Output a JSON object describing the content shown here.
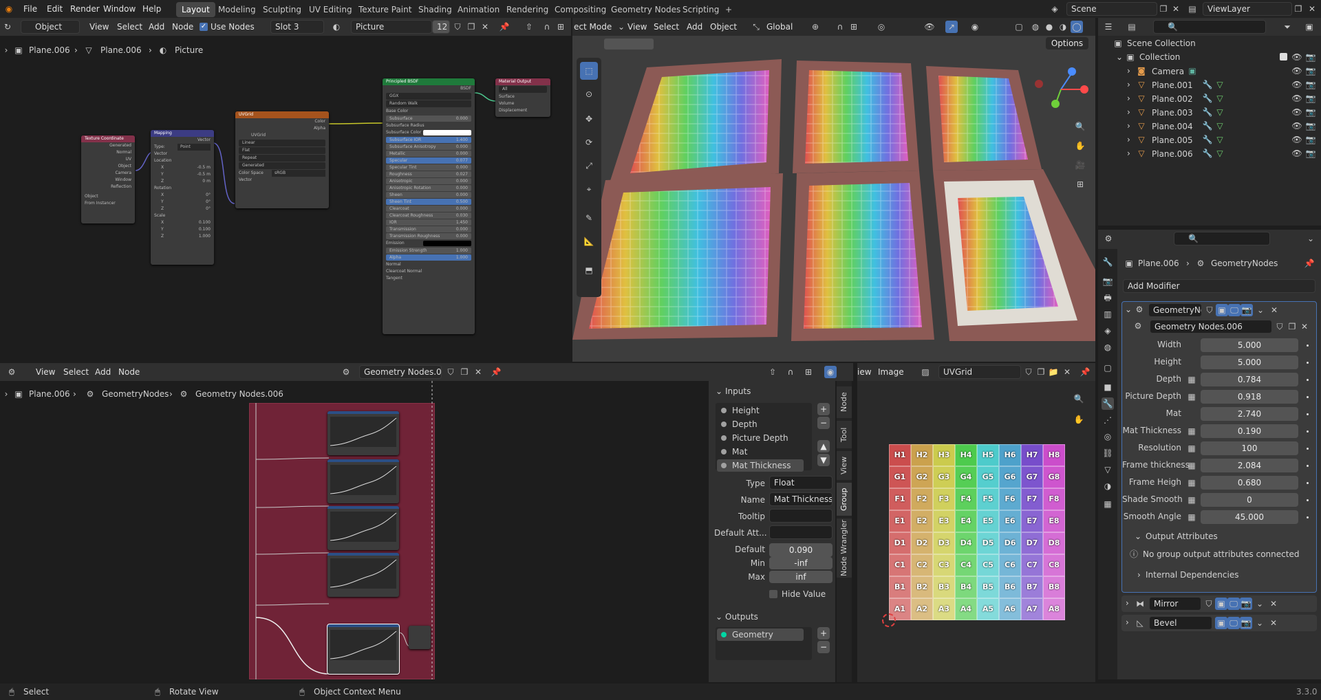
{
  "topbar": {
    "menus": [
      "File",
      "Edit",
      "Render",
      "Window",
      "Help"
    ],
    "workspaces": [
      "Layout",
      "Modeling",
      "Sculpting",
      "UV Editing",
      "Texture Paint",
      "Shading",
      "Animation",
      "Rendering",
      "Compositing",
      "Geometry Nodes",
      "Scripting"
    ],
    "active_workspace": "Layout",
    "add_tab": "+",
    "scene": "Scene",
    "view_layer": "ViewLayer"
  },
  "shader_editor": {
    "mode": "Object",
    "menus": [
      "View",
      "Select",
      "Add",
      "Node"
    ],
    "use_nodes_label": "Use Nodes",
    "slot": "Slot 3",
    "material": "Picture",
    "users": "12",
    "breadcrumb": [
      "Plane.006",
      "Plane.006",
      "Picture"
    ],
    "nodes": {
      "texcoord": {
        "title": "Texture Coordinate",
        "outputs": [
          "Generated",
          "Normal",
          "UV",
          "Object",
          "Camera",
          "Window",
          "Reflection"
        ],
        "object_label": "Object",
        "from_instancer": "From Instancer"
      },
      "mapping": {
        "title": "Mapping",
        "output": "Vector",
        "type_label": "Type:",
        "type_value": "Point",
        "rows": [
          "Vector",
          "Location",
          "X",
          "Y",
          "Z",
          "Rotation",
          "X",
          "Y",
          "Z",
          "Scale",
          "X",
          "Y",
          "Z"
        ],
        "values": [
          "-0.5 m",
          "-0.5 m",
          "0 m",
          "0°",
          "0°",
          "0°",
          "0.100",
          "0.100",
          "1.000"
        ]
      },
      "uvgrid": {
        "title": "UVGrid",
        "outputs": [
          "Color",
          "Alpha"
        ],
        "image": "UVGrid",
        "interp": "Linear",
        "proj": "Flat",
        "ext": "Repeat",
        "src": "Generated",
        "colorspace_label": "Color Space",
        "colorspace": "sRGB",
        "input": "Vector"
      },
      "bsdf": {
        "title": "Principled BSDF",
        "output": "BSDF",
        "dist": "GGX",
        "sss": "Random Walk",
        "rows": [
          [
            "Base Color",
            ""
          ],
          [
            "Subsurface",
            "0.000"
          ],
          [
            "Subsurface Radius",
            ""
          ],
          [
            "Subsurface Color",
            ""
          ],
          [
            "Subsurface IOR",
            "1.400"
          ],
          [
            "Subsurface Anisotropy",
            "0.000"
          ],
          [
            "Metallic",
            "0.000"
          ],
          [
            "Specular",
            "0.077"
          ],
          [
            "Specular Tint",
            "0.000"
          ],
          [
            "Roughness",
            "0.027"
          ],
          [
            "Anisotropic",
            "0.000"
          ],
          [
            "Anisotropic Rotation",
            "0.000"
          ],
          [
            "Sheen",
            "0.000"
          ],
          [
            "Sheen Tint",
            "0.500"
          ],
          [
            "Clearcoat",
            "0.000"
          ],
          [
            "Clearcoat Roughness",
            "0.030"
          ],
          [
            "IOR",
            "1.450"
          ],
          [
            "Transmission",
            "0.000"
          ],
          [
            "Transmission Roughness",
            "0.000"
          ],
          [
            "Emission",
            ""
          ],
          [
            "Emission Strength",
            "1.000"
          ],
          [
            "Alpha",
            "1.000"
          ],
          [
            "Normal",
            ""
          ],
          [
            "Clearcoat Normal",
            ""
          ],
          [
            "Tangent",
            ""
          ]
        ]
      },
      "output": {
        "title": "Material Output",
        "target": "All",
        "inputs": [
          "Surface",
          "Volume",
          "Displacement"
        ]
      }
    }
  },
  "viewport": {
    "mode": "Edit Mode",
    "mode_cut": "ect Mode",
    "menus": [
      "View",
      "Select",
      "Add",
      "Object"
    ],
    "transform": "Global",
    "options": "Options",
    "tools": [
      "select-box",
      "cursor",
      "move",
      "rotate",
      "scale",
      "transform",
      "annotate",
      "measure",
      "add-cube"
    ],
    "picture_count": 6
  },
  "outliner": {
    "search_placeholder": "",
    "root": "Scene Collection",
    "collection": "Collection",
    "items": [
      "Camera",
      "Plane.001",
      "Plane.002",
      "Plane.003",
      "Plane.004",
      "Plane.005",
      "Plane.006"
    ]
  },
  "properties": {
    "breadcrumb": [
      "Plane.006",
      "GeometryNodes"
    ],
    "add_modifier": "Add Modifier",
    "modifier_name": "GeometryNo...",
    "node_group": "Geometry Nodes.006",
    "params": [
      [
        "Width",
        "5.000"
      ],
      [
        "Height",
        "5.000"
      ],
      [
        "Depth",
        "0.784"
      ],
      [
        "Picture Depth",
        "0.918"
      ],
      [
        "Mat",
        "2.740"
      ],
      [
        "Mat Thickness",
        "0.190"
      ],
      [
        "Resolution",
        "100"
      ],
      [
        "Frame thickness",
        "2.084"
      ],
      [
        "Frame Heigh",
        "0.680"
      ],
      [
        "Shade Smooth",
        "0"
      ],
      [
        "Smooth Angle",
        "45.000"
      ]
    ],
    "output_attributes": "Output Attributes",
    "no_attributes": "No group output attributes connected",
    "internal_deps": "Internal Dependencies",
    "other_modifiers": [
      "Mirror",
      "Bevel"
    ]
  },
  "geo_editor": {
    "menus": [
      "View",
      "Select",
      "Add",
      "Node"
    ],
    "node_group": "Geometry Nodes.006",
    "breadcrumb": [
      "Plane.006",
      "GeometryNodes",
      "Geometry Nodes.006"
    ],
    "sidebar": {
      "inputs_title": "Inputs",
      "inputs": [
        "Height",
        "Depth",
        "Picture Depth",
        "Mat",
        "Mat Thickness"
      ],
      "selected_input": "Mat Thickness",
      "type_label": "Type",
      "type_value": "Float",
      "name_label": "Name",
      "name_value": "Mat Thickness",
      "tooltip_label": "Tooltip",
      "default_att_label": "Default Att...",
      "default_label": "Default",
      "default_value": "0.090",
      "min_label": "Min",
      "min_value": "-inf",
      "max_label": "Max",
      "max_value": "inf",
      "hide_value": "Hide Value",
      "outputs_title": "Outputs",
      "outputs": [
        "Geometry"
      ],
      "tabs": [
        "Node",
        "Tool",
        "View",
        "Group",
        "Node Wrangler"
      ]
    }
  },
  "image_editor": {
    "menus_cut": "iew",
    "image_menu": "Image",
    "image_name": "UVGrid",
    "grid_rows": [
      "H",
      "G",
      "F",
      "E",
      "D",
      "C",
      "B",
      "A"
    ],
    "grid_cols": [
      "1",
      "2",
      "3",
      "4",
      "5",
      "6",
      "7",
      "8"
    ]
  },
  "statusbar": {
    "select": "Select",
    "rotate": "Rotate View",
    "context": "Object Context Menu",
    "version": "3.3.0"
  }
}
